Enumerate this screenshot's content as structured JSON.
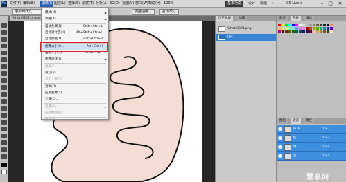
{
  "menubar": {
    "logo": "Ps",
    "items": [
      "文件(F)",
      "编辑(E)",
      "图像(I)",
      "图层(L)",
      "选择(S)",
      "滤镜(T)",
      "分析(A)",
      "3D(D)",
      "视图(V)",
      "窗口(W)",
      "帮助(H)"
    ],
    "zoom": "100%",
    "workspaces": [
      "基本功能",
      "设计",
      "绘画",
      "»"
    ],
    "cs_live": "CS Live ▾",
    "win_controls": [
      "–",
      "□",
      "×"
    ]
  },
  "options": {
    "mode_value": "添加到样式",
    "buttons": [
      "调整边缘...",
      "打印尺寸"
    ]
  },
  "document_tab": {
    "label": "fishot-0304.png @..."
  },
  "image_menu": {
    "items": [
      {
        "label": "模式(M)",
        "shortcut": "",
        "submenu": true,
        "disabled": false
      },
      {
        "label": "调整(A)",
        "shortcut": "",
        "submenu": true,
        "disabled": false
      },
      {
        "label": "自动色调(N)",
        "shortcut": "Shift+Ctrl+L",
        "submenu": false,
        "disabled": false
      },
      {
        "label": "自动对比度(U)",
        "shortcut": "Alt+Shift+Ctrl+L",
        "submenu": false,
        "disabled": false
      },
      {
        "label": "自动颜色(O)",
        "shortcut": "Shift+Ctrl+B",
        "submenu": false,
        "disabled": false
      },
      {
        "label": "图像大小(I)...",
        "shortcut": "Alt+Ctrl+I",
        "submenu": false,
        "disabled": false
      },
      {
        "label": "画布大小(S)...",
        "shortcut": "Alt+Ctrl+C",
        "submenu": false,
        "disabled": false
      },
      {
        "label": "图像旋转(G)",
        "shortcut": "",
        "submenu": true,
        "disabled": false
      },
      {
        "label": "裁剪(P)",
        "shortcut": "",
        "submenu": false,
        "disabled": true
      },
      {
        "label": "裁切(R)...",
        "shortcut": "",
        "submenu": false,
        "disabled": false
      },
      {
        "label": "显示全部(V)",
        "shortcut": "",
        "submenu": false,
        "disabled": true
      },
      {
        "label": "复制(D)...",
        "shortcut": "",
        "submenu": false,
        "disabled": false
      },
      {
        "label": "应用图像(Y)...",
        "shortcut": "",
        "submenu": false,
        "disabled": false
      },
      {
        "label": "计算(C)...",
        "shortcut": "",
        "submenu": false,
        "disabled": false
      },
      {
        "label": "变量(B)",
        "shortcut": "",
        "submenu": true,
        "disabled": true
      },
      {
        "label": "应用数据组(L)...",
        "shortcut": "",
        "submenu": false,
        "disabled": true
      },
      {
        "label": "陷印(T)...",
        "shortcut": "",
        "submenu": false,
        "disabled": true
      }
    ]
  },
  "history_panel": {
    "tabs": [
      "历史记录",
      "动作"
    ],
    "items": [
      "fishot-0304.png",
      "打开"
    ]
  },
  "swatch_panel": {
    "tabs": [
      "颜色",
      "色板",
      "样式"
    ],
    "colors": [
      "#ff0000",
      "#ffff00",
      "#00ff00",
      "#00ffff",
      "#0000ff",
      "#ff00ff",
      "#ffffff",
      "#e0e0e0",
      "#c0c0c0",
      "#a0a0a0",
      "#808080",
      "#606060",
      "#404040",
      "#202020",
      "#000000",
      "#ff8080",
      "#ffb380",
      "#ffe080",
      "#c0ff80",
      "#80ffb0",
      "#80e0ff",
      "#8090ff",
      "#c080ff",
      "#ff80d0",
      "#b00000",
      "#b05000",
      "#b0a000",
      "#50b000",
      "#00b070",
      "#0090b0",
      "#0030b0",
      "#6000b0",
      "#b00080",
      "#600000",
      "#603000",
      "#605800",
      "#306000",
      "#006040",
      "#004a60",
      "#001a60",
      "#300060",
      "#600040",
      "#f2c6a0",
      "#d8a070",
      "#b07840",
      "#805020",
      "#503010",
      "#f0e0d0"
    ]
  },
  "channels_panel": {
    "tabs": [
      "图层",
      "通道",
      "路径"
    ],
    "rows": [
      {
        "name": "RGB",
        "key": "Ctrl+2"
      },
      {
        "name": "红",
        "key": "Ctrl+3"
      },
      {
        "name": "绿",
        "key": "Ctrl+4"
      },
      {
        "name": "蓝",
        "key": "Ctrl+5"
      }
    ]
  },
  "colors": {
    "highlight_box": "#e0202a",
    "shape_fill": "#f3ddd5",
    "shape_stroke": "#111111",
    "selection_blue": "#3f8fe0"
  },
  "watermark": "慧享网"
}
